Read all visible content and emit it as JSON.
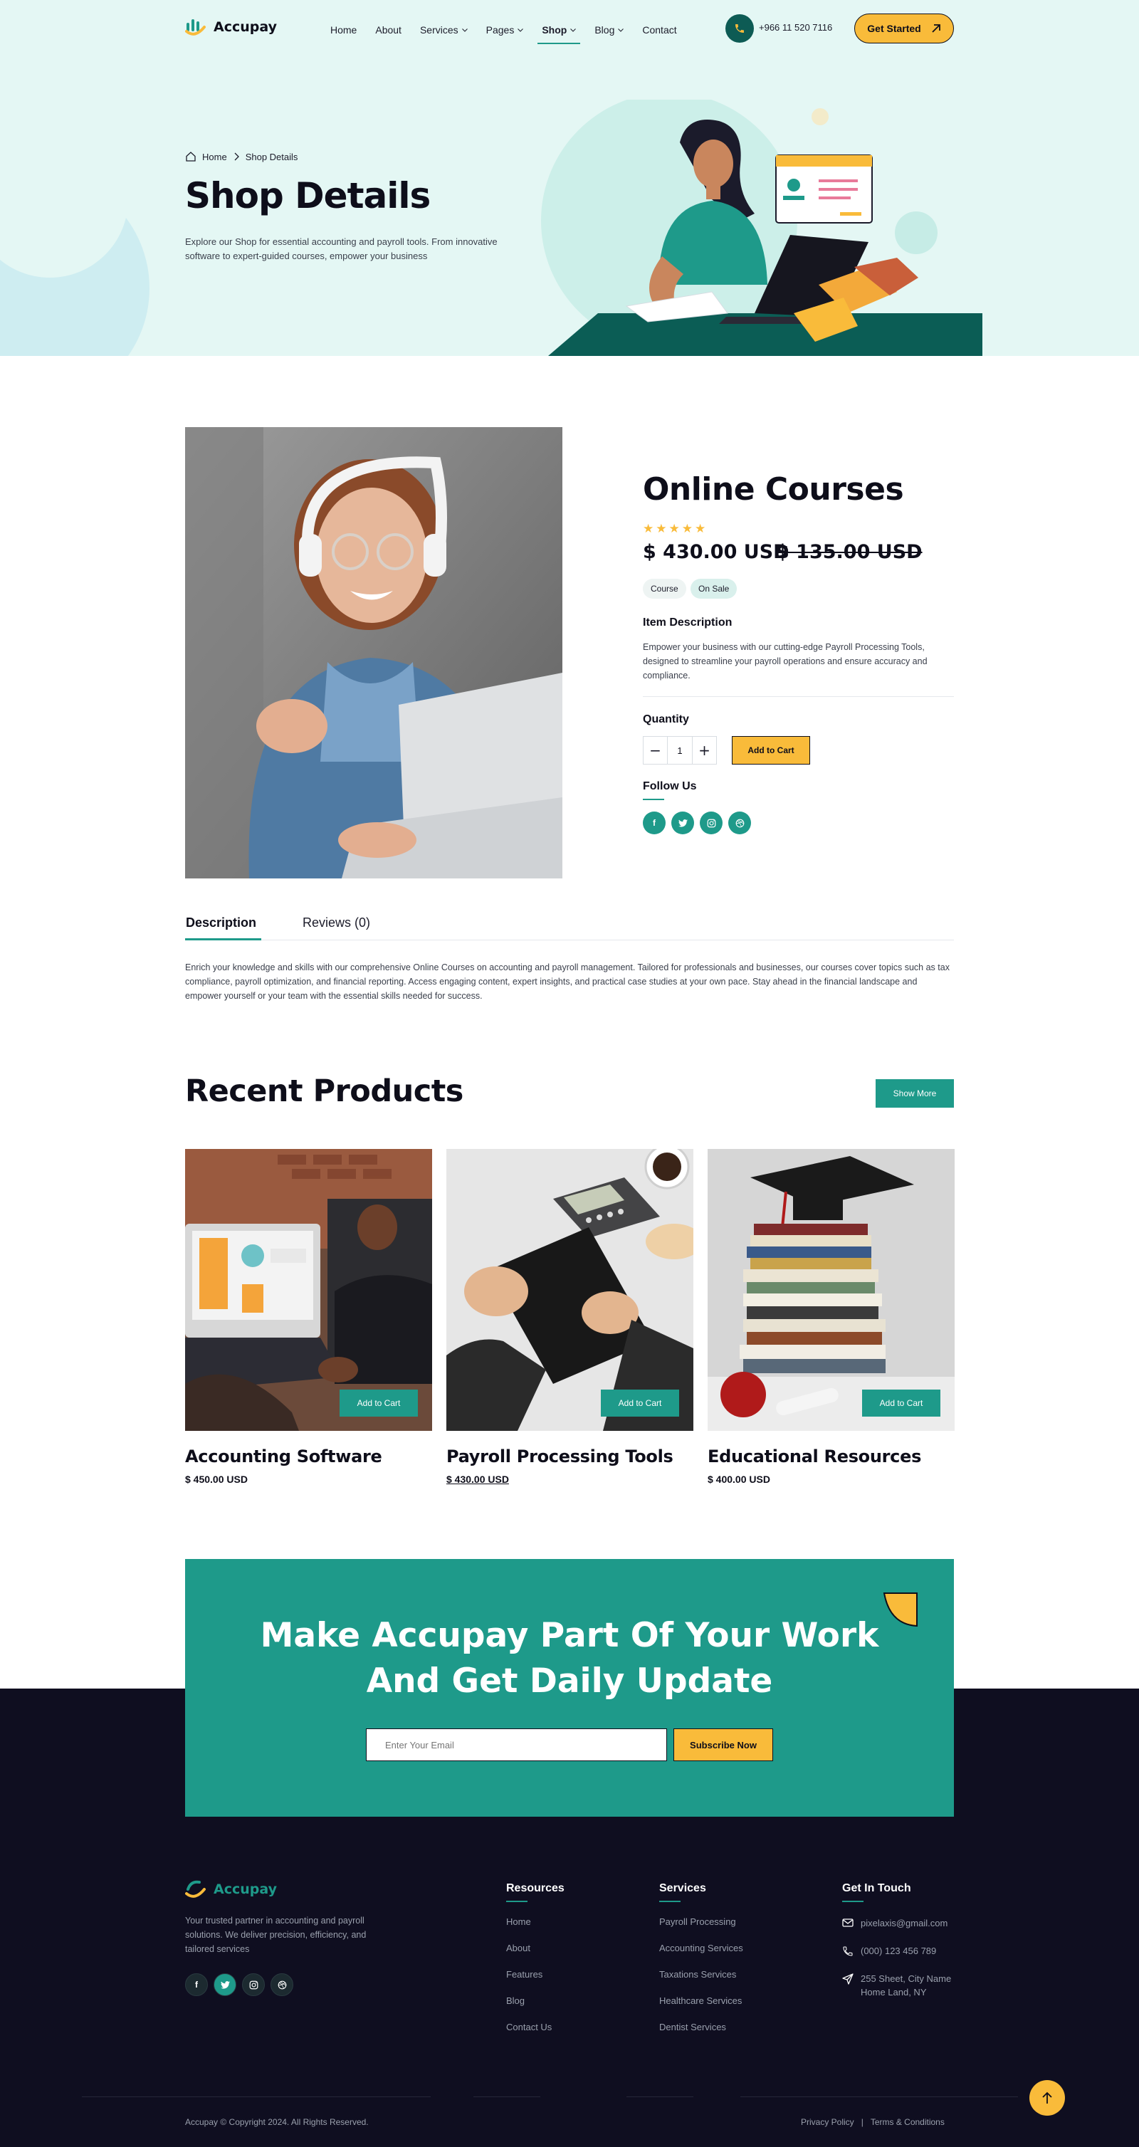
{
  "header": {
    "brand": "Accupay",
    "nav": [
      {
        "label": "Home",
        "dropdown": false,
        "active": false
      },
      {
        "label": "About",
        "dropdown": false,
        "active": false
      },
      {
        "label": "Services",
        "dropdown": true,
        "active": false
      },
      {
        "label": "Pages",
        "dropdown": true,
        "active": false
      },
      {
        "label": "Shop",
        "dropdown": true,
        "active": true
      },
      {
        "label": "Blog",
        "dropdown": true,
        "active": false
      },
      {
        "label": "Contact",
        "dropdown": false,
        "active": false
      }
    ],
    "phone": "+966 11 520 7116",
    "cta": "Get Started"
  },
  "hero": {
    "breadcrumb": [
      "Home",
      "Shop Details"
    ],
    "title": "Shop Details",
    "description": "Explore our Shop for essential accounting and payroll tools. From innovative software to expert-guided courses, empower your business"
  },
  "product": {
    "title": "Online Courses",
    "rating": 5,
    "price": "$ 430.00 USD",
    "old_price": "$ 135.00 USD",
    "tags": [
      "Course",
      "On Sale"
    ],
    "item_description_label": "Item Description",
    "item_description": "Empower your business with our cutting-edge Payroll Processing Tools, designed to streamline your payroll operations and ensure accuracy and compliance.",
    "quantity_label": "Quantity",
    "quantity": "1",
    "add_to_cart": "Add to Cart",
    "follow_label": "Follow Us",
    "social": [
      "facebook-icon",
      "twitter-icon",
      "instagram-icon",
      "dribbble-icon"
    ]
  },
  "tabs": {
    "items": [
      "Description",
      "Reviews (0)"
    ],
    "active": 0,
    "description": "Enrich your knowledge and skills with our comprehensive Online Courses on accounting and payroll management. Tailored for professionals and businesses, our courses cover topics such as tax compliance, payroll optimization, and financial reporting. Access engaging content, expert insights, and practical case studies at your own pace. Stay ahead in the financial landscape and empower yourself or your team with the essential skills needed for success."
  },
  "recent": {
    "title": "Recent Products",
    "show_more": "Show More",
    "products": [
      {
        "title": "Accounting Software",
        "price": "$ 450.00 USD",
        "button": "Add to Cart"
      },
      {
        "title": "Payroll Processing Tools",
        "price": "$ 430.00 USD",
        "button": "Add to Cart"
      },
      {
        "title": "Educational Resources",
        "price": "$ 400.00 USD",
        "button": "Add to Cart"
      }
    ]
  },
  "newsletter": {
    "title_line1": "Make Accupay Part Of Your Work",
    "title_line2": "And Get Daily Update",
    "placeholder": "Enter Your Email",
    "button": "Subscribe Now"
  },
  "footer": {
    "brand": "Accupay",
    "description": "Your trusted partner in accounting and payroll solutions. We deliver precision, efficiency, and tailored services",
    "resources_title": "Resources",
    "resources": [
      "Home",
      "About",
      "Features",
      "Blog",
      "Contact Us"
    ],
    "services_title": "Services",
    "services": [
      "Payroll Processing",
      "Accounting Services",
      "Taxations Services",
      "Healthcare Services",
      "Dentist Services"
    ],
    "contact_title": "Get In Touch",
    "email": "pixelaxis@gmail.com",
    "phone": "(000) 123 456 789",
    "address_line1": "255 Sheet, City Name",
    "address_line2": "Home Land, NY",
    "copyright": "Accupay © Copyright 2024. All Rights Reserved.",
    "privacy": "Privacy Policy",
    "separator": "|",
    "terms": "Terms & Conditions"
  },
  "colors": {
    "teal": "#1e9a8a",
    "dark_teal": "#0d5b54",
    "yellow": "#f9bb3a",
    "navy": "#0f0e20",
    "hero_bg": "#e4f7f4"
  }
}
